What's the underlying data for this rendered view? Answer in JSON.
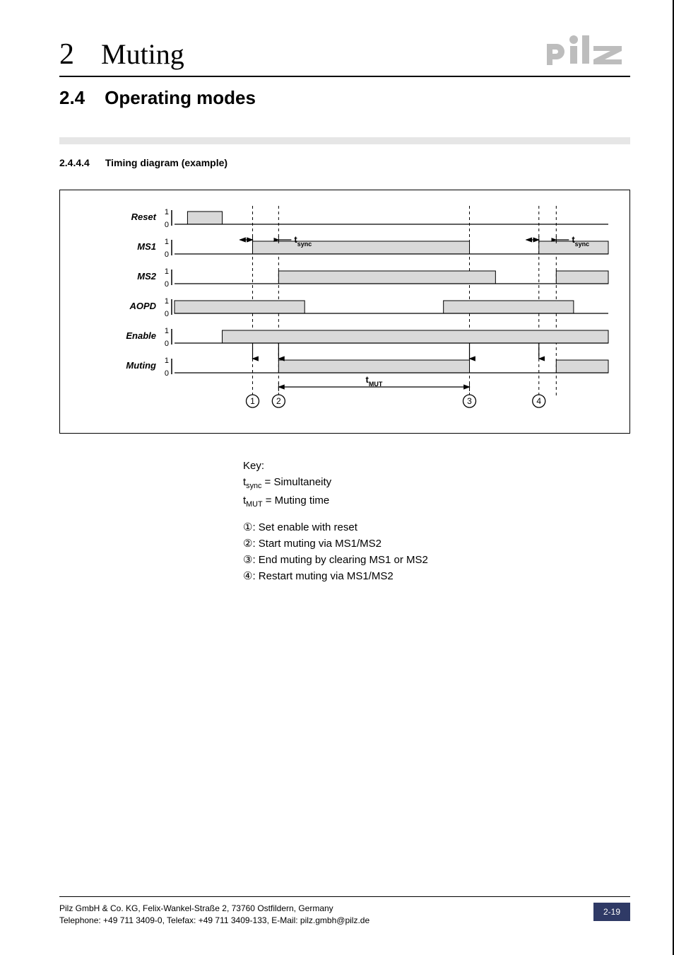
{
  "header": {
    "chapter_num": "2",
    "chapter_title": "Muting",
    "logo_name": "pilz"
  },
  "section": {
    "num": "2.4",
    "title": "Operating modes"
  },
  "subsection": {
    "num": "2.4.4.4",
    "title": "Timing diagram (example)"
  },
  "timing_diagram": {
    "signals": [
      "Reset",
      "MS1",
      "MS2",
      "AOPD",
      "Enable",
      "Muting"
    ],
    "y_ticks": [
      "1",
      "0"
    ],
    "annotations": {
      "tsync_label_left": "t",
      "tsync_sub_left": "sync",
      "tsync_label_right": "t",
      "tsync_sub_right": "sync",
      "tmut_label": "t",
      "tmut_sub": "MUT",
      "event_1": "1",
      "event_2": "2",
      "event_3": "3",
      "event_4": "4"
    }
  },
  "key": {
    "title": "Key:",
    "line_tsync_pre": "t",
    "line_tsync_sub": "sync",
    "line_tsync_post": " = Simultaneity",
    "line_tmut_pre": "t",
    "line_tmut_sub": "MUT",
    "line_tmut_post": " = Muting time",
    "items": [
      {
        "mark": "①",
        "text": ": Set enable with reset"
      },
      {
        "mark": "②",
        "text": ": Start muting via MS1/MS2"
      },
      {
        "mark": "③",
        "text": ": End muting by clearing MS1 or MS2"
      },
      {
        "mark": "④",
        "text": ": Restart muting via MS1/MS2"
      }
    ]
  },
  "footer": {
    "line1": "Pilz GmbH & Co. KG, Felix-Wankel-Straße 2, 73760 Ostfildern, Germany",
    "line2": "Telephone: +49 711 3409-0, Telefax: +49 711 3409-133, E-Mail: pilz.gmbh@pilz.de",
    "page_badge": "2-19"
  },
  "chart_data": {
    "type": "timing",
    "x_range": [
      0,
      100
    ],
    "signals": [
      {
        "name": "Reset",
        "intervals_high": [
          [
            3,
            11
          ]
        ]
      },
      {
        "name": "MS1",
        "intervals_high": [
          [
            18,
            68
          ],
          [
            84,
            100
          ]
        ]
      },
      {
        "name": "MS2",
        "intervals_high": [
          [
            24,
            74
          ],
          [
            88,
            100
          ]
        ]
      },
      {
        "name": "AOPD",
        "intervals_high": [
          [
            0,
            30
          ],
          [
            62,
            92
          ]
        ]
      },
      {
        "name": "Enable",
        "intervals_high": [
          [
            11,
            100
          ]
        ]
      },
      {
        "name": "Muting",
        "intervals_high": [
          [
            24,
            68
          ],
          [
            88,
            100
          ]
        ]
      }
    ],
    "vertical_guides": [
      18,
      24,
      68,
      84,
      88
    ],
    "event_markers": {
      "1": 18,
      "2": 24,
      "3": 68,
      "4": 84
    },
    "time_spans": {
      "t_sync_1": [
        18,
        24
      ],
      "t_sync_2": [
        84,
        88
      ],
      "t_MUT": [
        24,
        68
      ]
    }
  }
}
